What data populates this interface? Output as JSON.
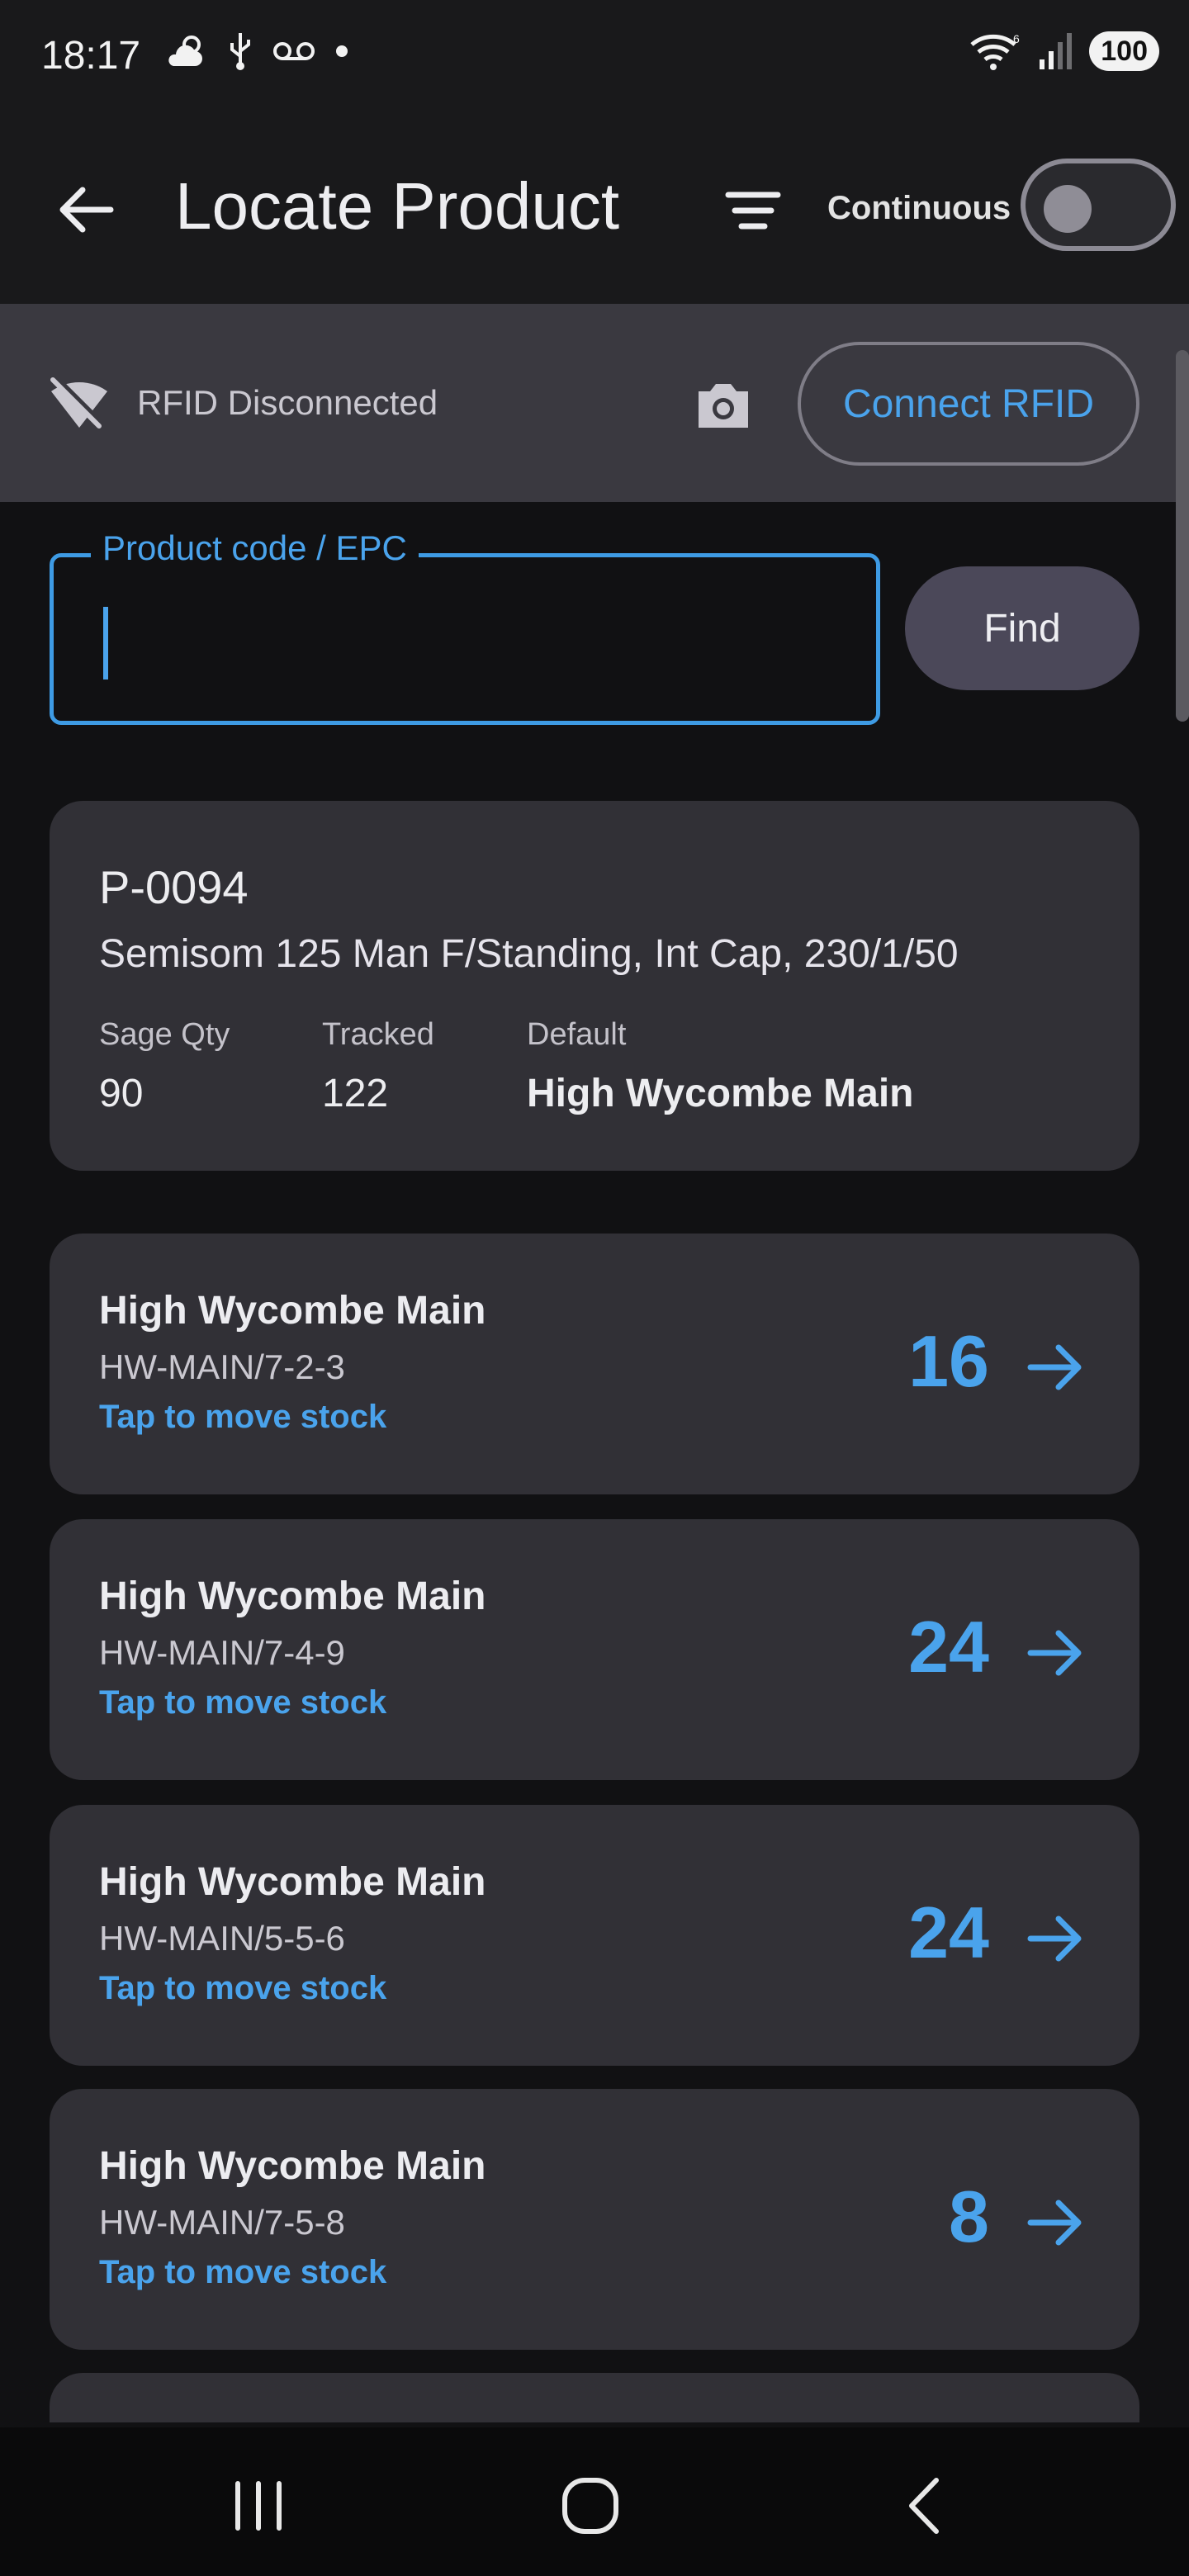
{
  "status_bar": {
    "time": "18:17",
    "left_icons": [
      "weather-cloud-sun-icon",
      "usb-icon",
      "voicemail-icon",
      "dot-icon"
    ],
    "right_icons": [
      "wifi-6-icon",
      "signal-icon"
    ],
    "battery": "100"
  },
  "app_bar": {
    "title": "Locate Product",
    "continuous_label": "Continuous",
    "continuous_on": false
  },
  "rfid": {
    "status": "RFID Disconnected",
    "connect_label": "Connect RFID"
  },
  "search": {
    "label": "Product code / EPC",
    "value": "",
    "find_label": "Find"
  },
  "product": {
    "code": "P-0094",
    "description": "Semisom 125 Man F/Standing, Int Cap, 230/1/50",
    "sage_qty_label": "Sage Qty",
    "sage_qty": "90",
    "tracked_label": "Tracked",
    "tracked": "122",
    "default_label": "Default",
    "default": "High Wycombe Main"
  },
  "locations": [
    {
      "name": "High Wycombe Main",
      "code": "HW-MAIN/7-2-3",
      "hint": "Tap to move stock",
      "qty": "16"
    },
    {
      "name": "High Wycombe Main",
      "code": "HW-MAIN/7-4-9",
      "hint": "Tap to move stock",
      "qty": "24"
    },
    {
      "name": "High Wycombe Main",
      "code": "HW-MAIN/5-5-6",
      "hint": "Tap to move stock",
      "qty": "24"
    },
    {
      "name": "High Wycombe Main",
      "code": "HW-MAIN/7-5-8",
      "hint": "Tap to move stock",
      "qty": "8"
    }
  ],
  "colors": {
    "accent": "#4aa3ec",
    "card": "#313036",
    "background": "#111113",
    "rfid_bar": "#3a3940"
  }
}
